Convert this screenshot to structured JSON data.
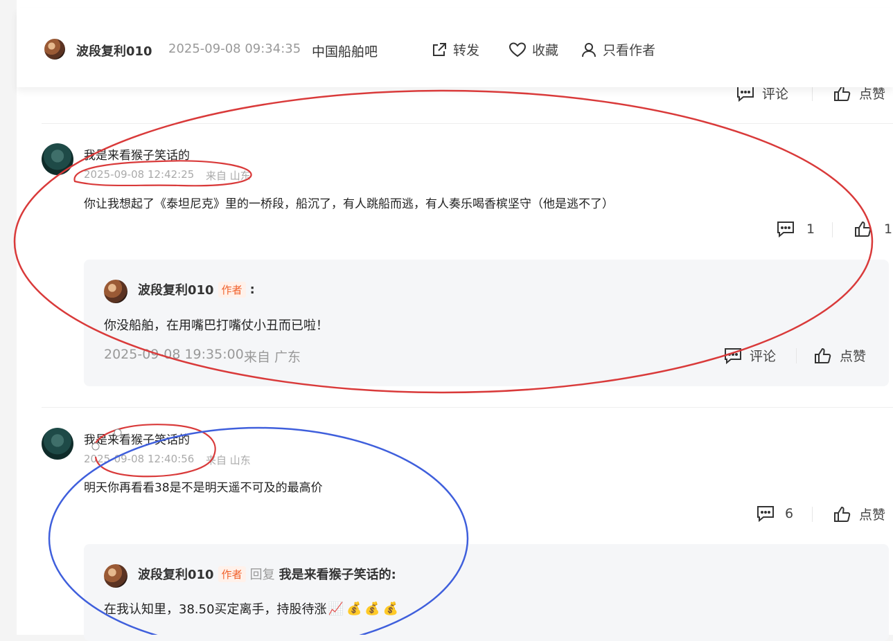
{
  "header": {
    "author": "波段复利010",
    "datetime": "2025-09-08 09:34:35",
    "forum": "中国船舶吧",
    "share_label": "转发",
    "collect_label": "收藏",
    "only_author_label": "只看作者"
  },
  "top_actions": {
    "comment_label": "评论",
    "like_label": "点赞"
  },
  "comments": [
    {
      "username": "我是来看猴子笑话的",
      "time": "2025-09-08 12:42:25",
      "location": "来自 山东",
      "content": "你让我想起了《泰坦尼克》里的一桥段，船沉了，有人跳船而逃，有人奏乐喝香槟坚守（他是逃不了）",
      "comment_count": "1",
      "like_count": "1",
      "reply": {
        "username": "波段复利010",
        "author_tag": "作者",
        "colon": ":",
        "content": "你没船舶，在用嘴巴打嘴仗小丑而已啦！",
        "time": "2025-09-08 19:35:00",
        "location": "来自 广东",
        "comment_label": "评论",
        "like_label": "点赞"
      }
    },
    {
      "username": "我是来看猴子笑话的",
      "time": "2025-09-08 12:40:56",
      "location": "来自 山东",
      "content": "明天你再看看38是不是明天遥不可及的最高价",
      "comment_count": "6",
      "like_label": "点赞",
      "reply": {
        "username": "波段复利010",
        "author_tag": "作者",
        "reply_word": "回复",
        "reply_to": "我是来看猴子笑话的:",
        "content": "在我认知里，38.50买定离手，持股待涨",
        "emojis": "📈💰💰💰"
      }
    }
  ],
  "annotation_colors": {
    "red": "#d93a3a",
    "blue": "#3f5fdc"
  }
}
